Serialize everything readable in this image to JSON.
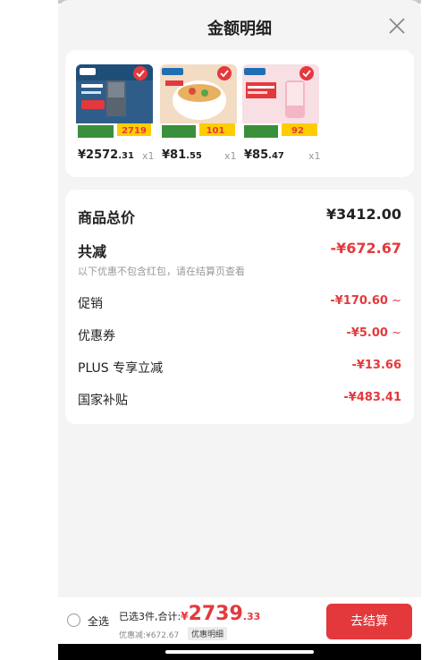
{
  "sheet": {
    "title": "金额明细"
  },
  "products": [
    {
      "price_int": "¥2572",
      "price_dec": ".31",
      "qty": "x1"
    },
    {
      "price_int": "¥81",
      "price_dec": ".55",
      "qty": "x1"
    },
    {
      "price_int": "¥85",
      "price_dec": ".47",
      "qty": "x1"
    }
  ],
  "product_tags": {
    "p1_price": "2719",
    "p2_price": "101",
    "p3_price": "92"
  },
  "summary": {
    "total_label": "商品总价",
    "total_value": "¥3412.00",
    "discount_label": "共减",
    "discount_value": "-¥672.67",
    "discount_note": "以下优惠不包含红包，请在结算页查看",
    "items": [
      {
        "label": "促销",
        "value": "-¥170.60",
        "chevron": "~"
      },
      {
        "label": "优惠券",
        "value": "-¥5.00",
        "chevron": "~"
      },
      {
        "label": "PLUS 专享立减",
        "value": "-¥13.66",
        "chevron": ""
      },
      {
        "label": "国家补贴",
        "value": "-¥483.41",
        "chevron": ""
      }
    ]
  },
  "bottom": {
    "select_all": "全选",
    "selected_text": "已选3件,合计:",
    "currency": "¥",
    "total_int": "2739",
    "total_dec": ".33",
    "discount_text": "优惠减:¥672.67",
    "detail_btn": "优惠明细",
    "checkout": "去结算"
  },
  "colors": {
    "accent": "#e4393c",
    "sheet_bg": "#f4f4f4"
  }
}
